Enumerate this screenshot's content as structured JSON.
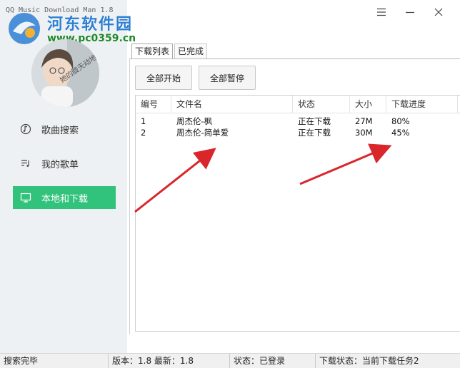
{
  "window": {
    "title": "QQ Music Download Man 1.8"
  },
  "watermark": {
    "title": "河东软件园",
    "url": "www.pc0359.cn"
  },
  "avatar": {
    "caption": "她的胧天动地"
  },
  "sidebar": {
    "items": [
      {
        "label": "歌曲搜索",
        "icon": "music-note-circle-icon",
        "active": false
      },
      {
        "label": "我的歌单",
        "icon": "playlist-icon",
        "active": false
      },
      {
        "label": "本地和下载",
        "icon": "monitor-icon",
        "active": true
      }
    ]
  },
  "tabs": [
    {
      "label": "下载列表",
      "active": true
    },
    {
      "label": "已完成",
      "active": false
    }
  ],
  "toolbar": {
    "start_all": "全部开始",
    "pause_all": "全部暂停"
  },
  "table": {
    "columns": [
      "编号",
      "文件名",
      "状态",
      "大小",
      "下载进度"
    ],
    "rows": [
      [
        "1",
        "周杰伦-枫",
        "正在下载",
        "27M",
        "80%"
      ],
      [
        "2",
        "周杰伦-简单爱",
        "正在下载",
        "30M",
        "45%"
      ]
    ]
  },
  "statusbar": {
    "message": "搜索完毕",
    "version": "版本：1.8 最新：1.8",
    "login": "状态：已登录",
    "download": "下载状态：当前下载任务2"
  },
  "colors": {
    "accent": "#31c27c",
    "sidebar_bg": "#eef1f3",
    "annotation_arrow": "#d9262a"
  }
}
